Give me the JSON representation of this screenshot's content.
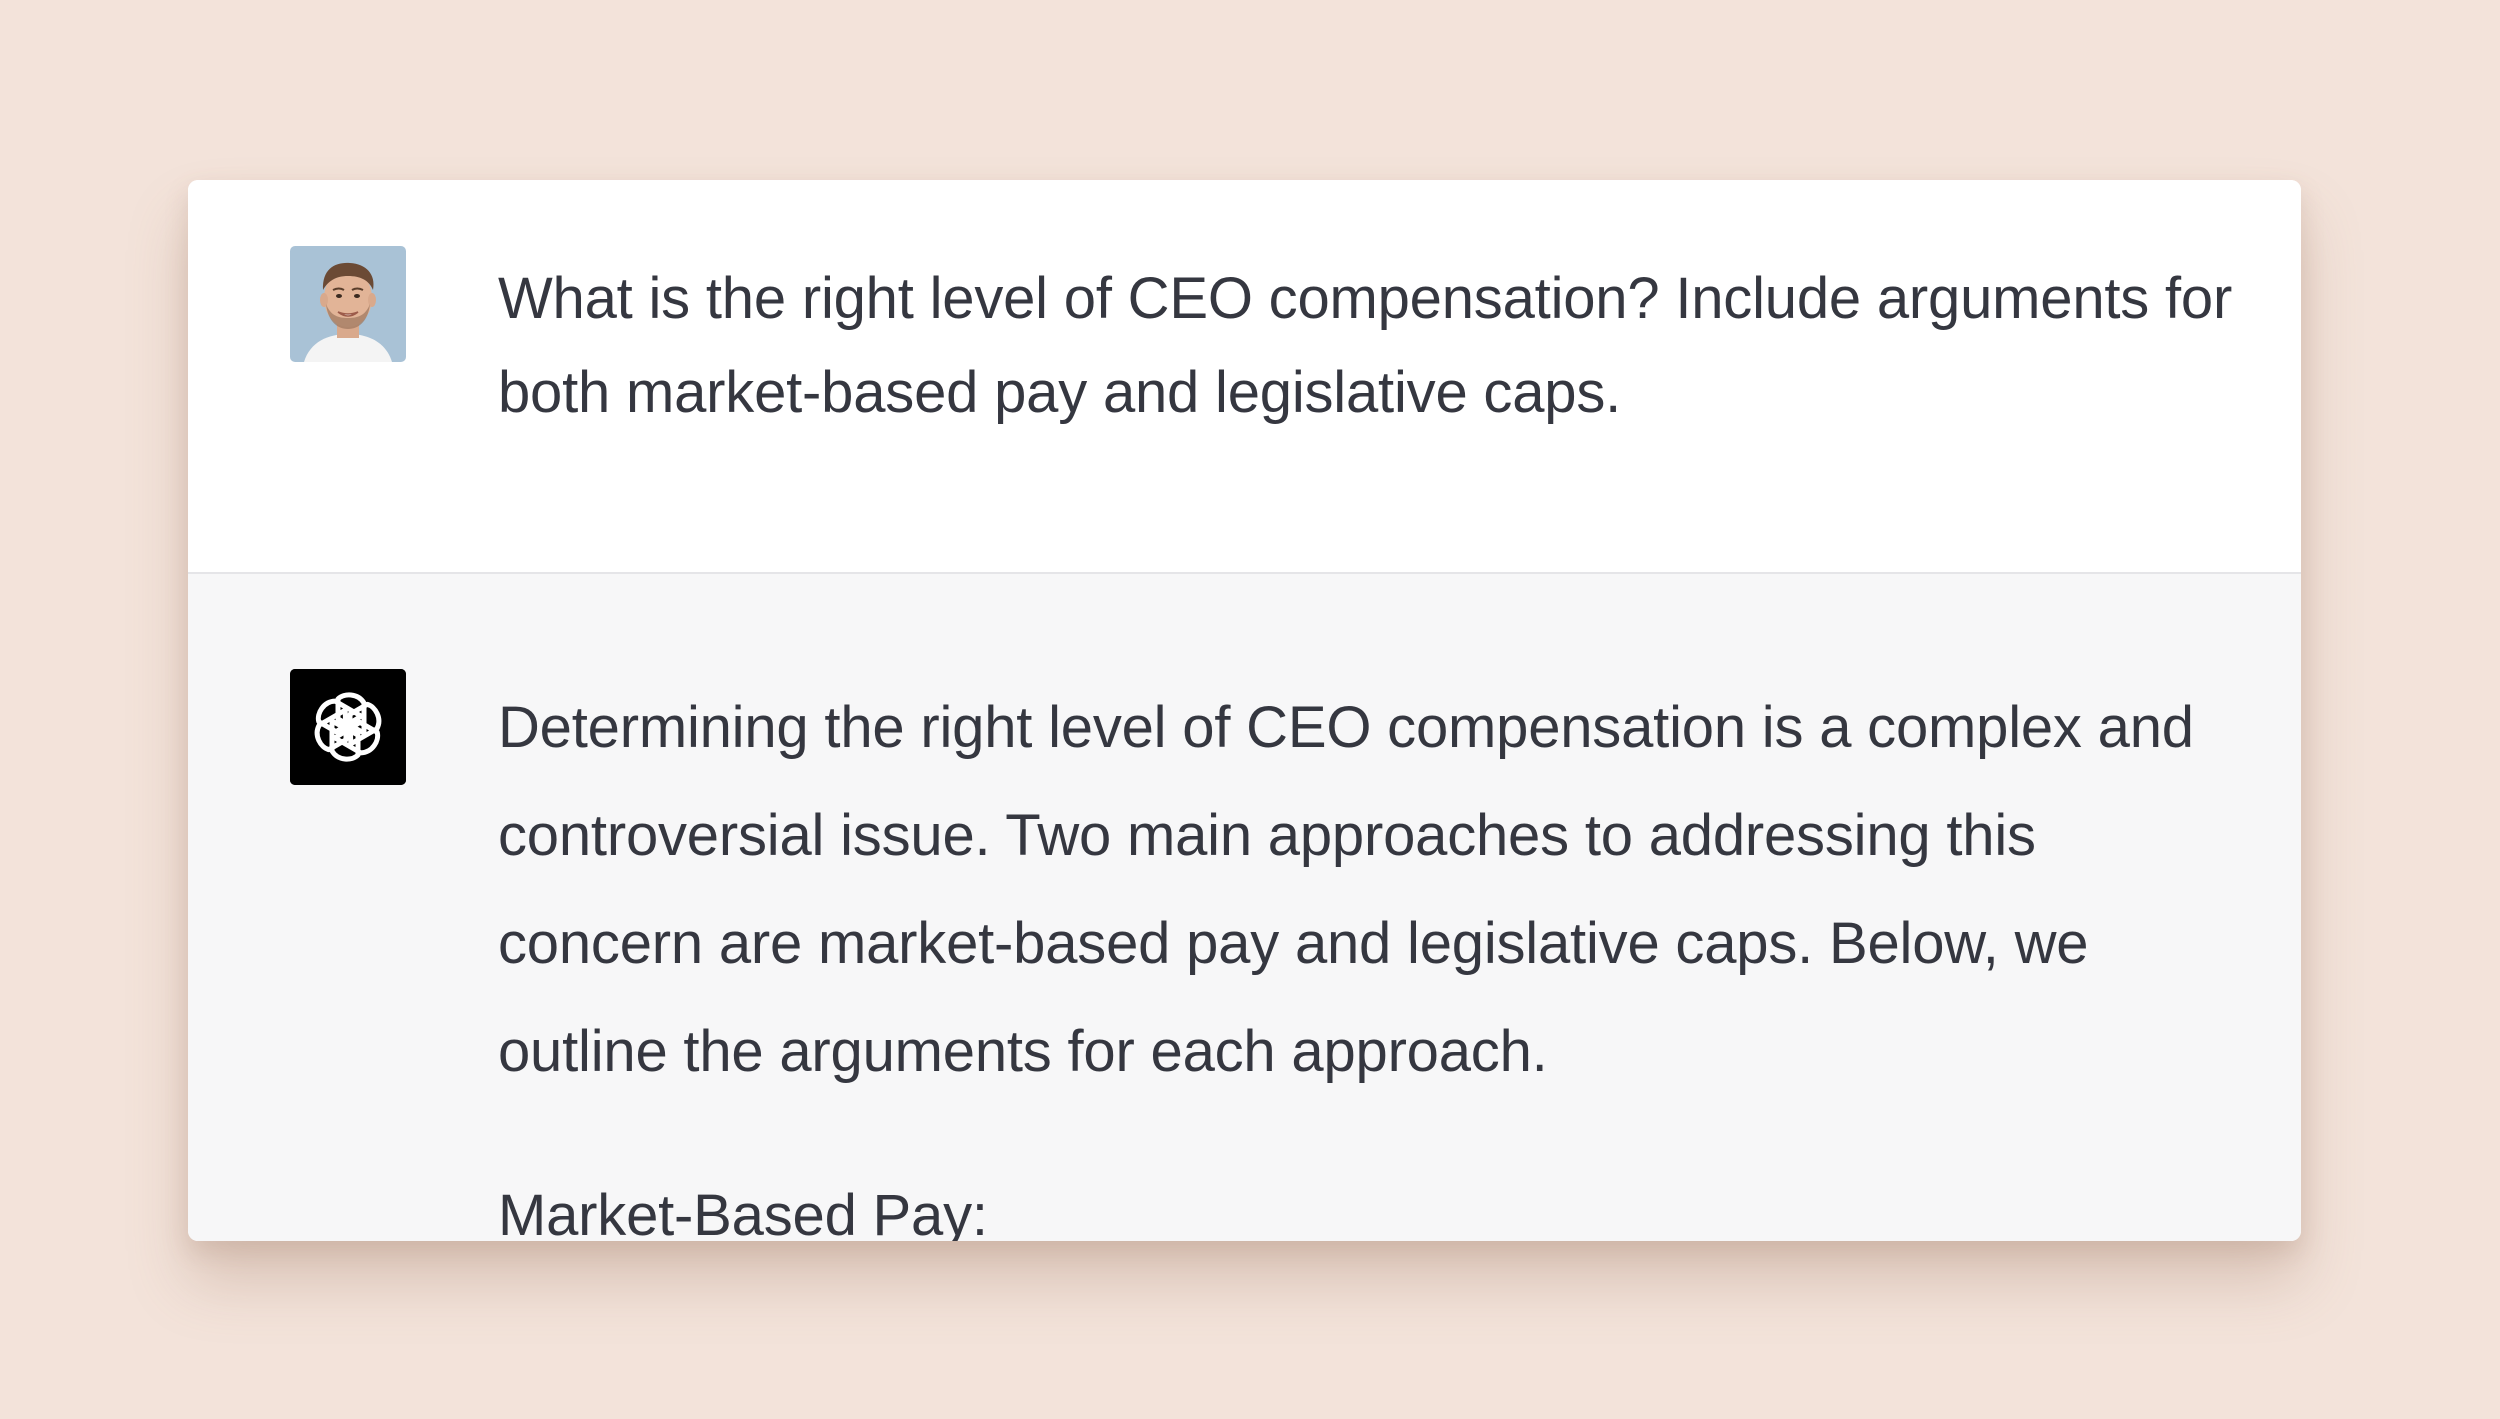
{
  "conversation": {
    "user_message": {
      "avatar": "user-photo-avatar",
      "text": "What is the right level of CEO compensation? Include arguments for both market-based pay and legislative caps."
    },
    "assistant_message": {
      "avatar": "openai-logo-icon",
      "paragraph": "Determining the right level of CEO compensation is a complex and controversial issue. Two main approaches to addressing this concern are market-based pay and legislative caps. Below, we outline the arguments for each approach.",
      "section_heading": "Market-Based Pay:"
    }
  },
  "colors": {
    "background": "#f3e3da",
    "user_row": "#ffffff",
    "assistant_row": "#f7f7f8",
    "text": "#353740"
  }
}
